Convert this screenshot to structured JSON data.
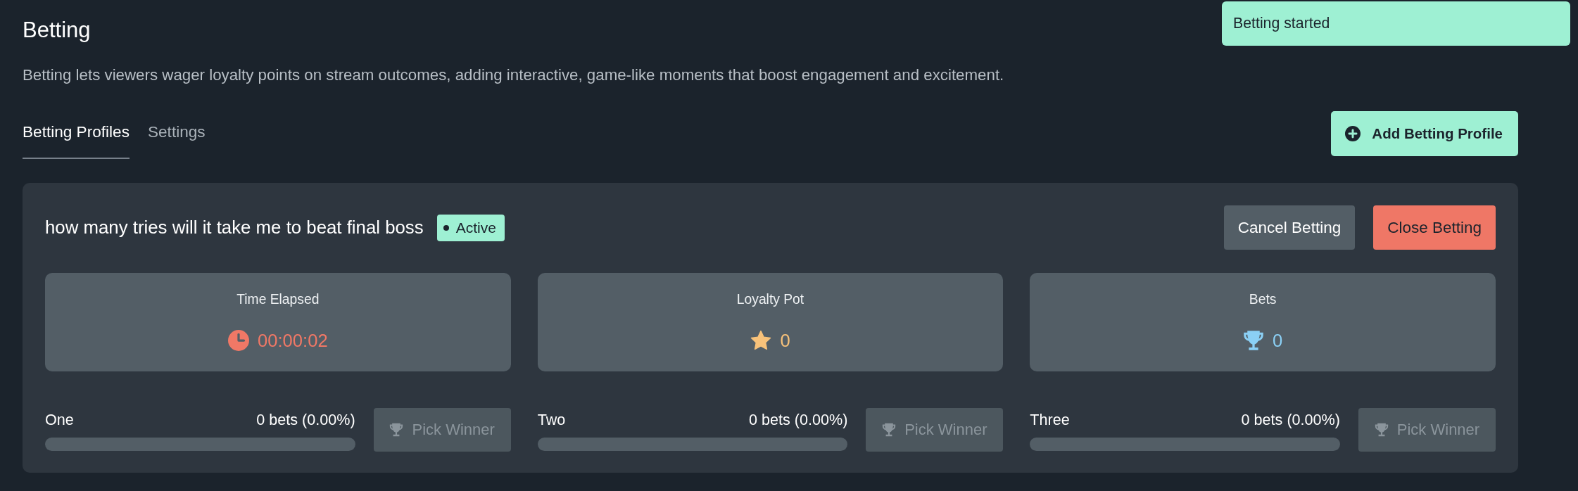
{
  "page": {
    "title": "Betting",
    "description": "Betting lets viewers wager loyalty points on stream outcomes, adding interactive, game-like moments that boost engagement and excitement."
  },
  "toast": {
    "message": "Betting started"
  },
  "tabs": [
    {
      "label": "Betting Profiles",
      "selected": true
    },
    {
      "label": "Settings",
      "selected": false
    }
  ],
  "add_button": {
    "label": "Add Betting Profile"
  },
  "profile": {
    "title": "how many tries will it take me to beat final boss",
    "badge": {
      "label": "Active"
    },
    "actions": [
      {
        "label": "Cancel Betting",
        "kind": "secondary"
      },
      {
        "label": "Close Betting",
        "kind": "danger"
      }
    ],
    "stats": [
      {
        "label": "Time Elapsed",
        "value": "00:00:02",
        "kind": "clock",
        "color": "#f07866"
      },
      {
        "label": "Loyalty Pot",
        "value": "0",
        "kind": "star",
        "color": "#f8c27a"
      },
      {
        "label": "Bets",
        "value": "0",
        "kind": "trophy",
        "color": "#8bd0f5"
      }
    ],
    "options": [
      {
        "label": "One",
        "reading": "0 bets (0.00%)",
        "level": 0,
        "button": "Pick Winner",
        "disabled": true
      },
      {
        "label": "Two",
        "reading": "0 bets (0.00%)",
        "level": 0,
        "button": "Pick Winner",
        "disabled": true
      },
      {
        "label": "Three",
        "reading": "0 bets (0.00%)",
        "level": 0,
        "button": "Pick Winner",
        "disabled": true
      }
    ]
  }
}
